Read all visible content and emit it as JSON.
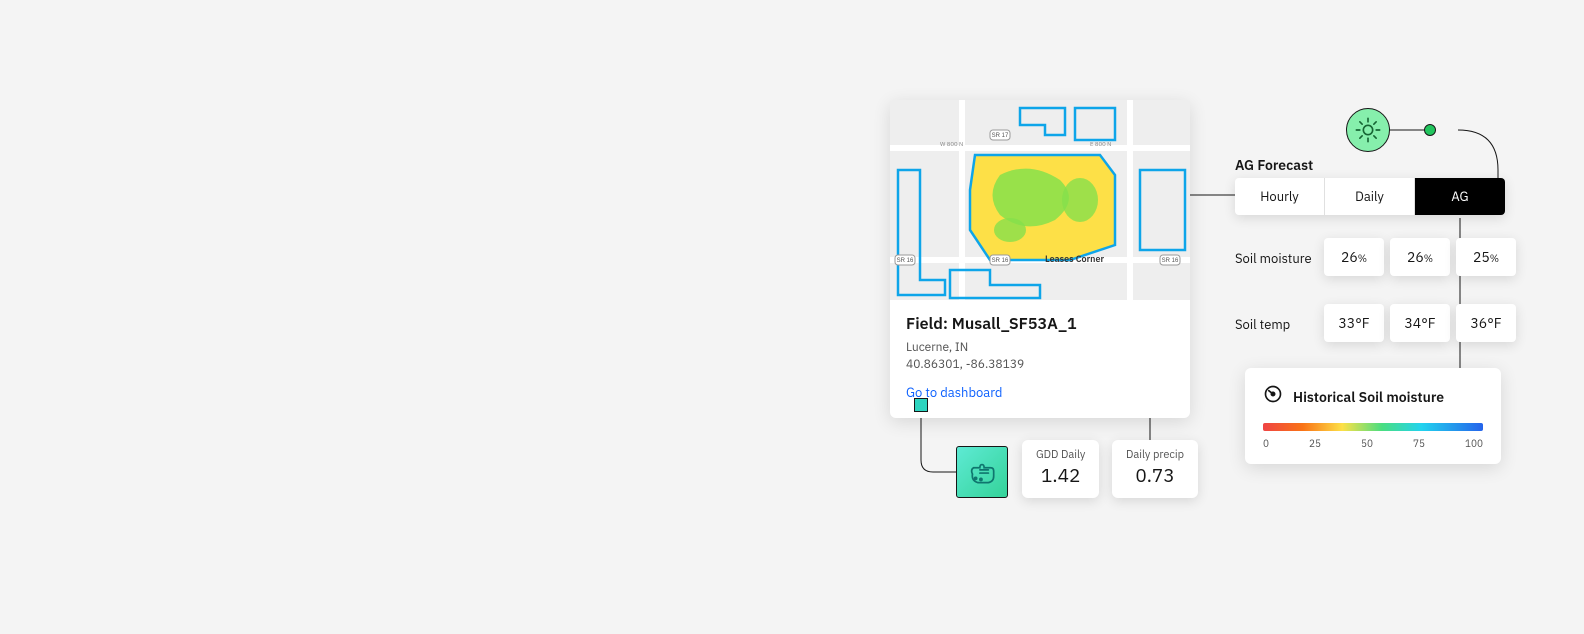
{
  "field": {
    "title": "Field: Musall_SF53A_1",
    "location": "Lucerne, IN",
    "coords": "40.86301, -86.38139",
    "dashboard_link": "Go to dashboard",
    "map_labels": {
      "leases_corner": "Leases Corner"
    }
  },
  "metrics": {
    "gdd": {
      "label": "GDD Daily",
      "value": "1.42"
    },
    "precip": {
      "label": "Daily precip",
      "value": "0.73"
    }
  },
  "forecast": {
    "title": "AG Forecast",
    "tabs": [
      {
        "label": "Hourly",
        "active": false
      },
      {
        "label": "Daily",
        "active": false
      },
      {
        "label": "AG",
        "active": true
      }
    ],
    "rows": [
      {
        "label": "Soil moisture",
        "values": [
          "26",
          "26",
          "25"
        ],
        "unit": "%"
      },
      {
        "label": "Soil temp",
        "values": [
          "33°F",
          "34°F",
          "36°F"
        ],
        "unit": ""
      }
    ]
  },
  "historical": {
    "title": "Historical Soil moisture",
    "scale": [
      "0",
      "25",
      "50",
      "75",
      "100"
    ]
  }
}
